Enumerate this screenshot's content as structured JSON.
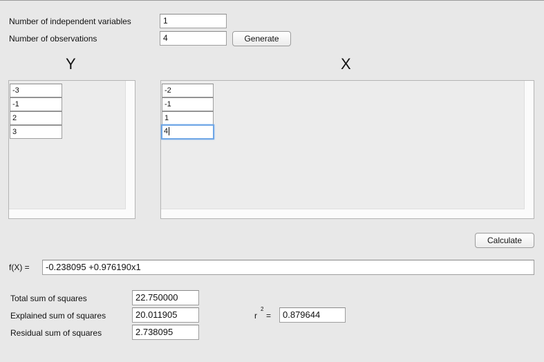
{
  "settings": {
    "num_vars_label": "Number of independent variables",
    "num_vars_value": "1",
    "num_obs_label": "Number of observations",
    "num_obs_value": "4",
    "generate_label": "Generate"
  },
  "y_panel": {
    "heading": "Y",
    "values": [
      "-3",
      "-1",
      "2",
      "3"
    ]
  },
  "x_panel": {
    "heading": "X",
    "values": [
      "-2",
      "-1",
      "1",
      "4"
    ]
  },
  "calculate_label": "Calculate",
  "formula": {
    "label": "f(X) =",
    "value": "-0.238095 +0.976190x1"
  },
  "results": {
    "tss_label": "Total sum of squares",
    "tss_value": "22.750000",
    "ess_label": "Explained sum of squares",
    "ess_value": "20.011905",
    "rss_label": "Residual sum of squares",
    "rss_value": "2.738095",
    "r2_base": "r",
    "r2_exp": "2",
    "r2_eq": "=",
    "r2_value": "0.879644"
  }
}
